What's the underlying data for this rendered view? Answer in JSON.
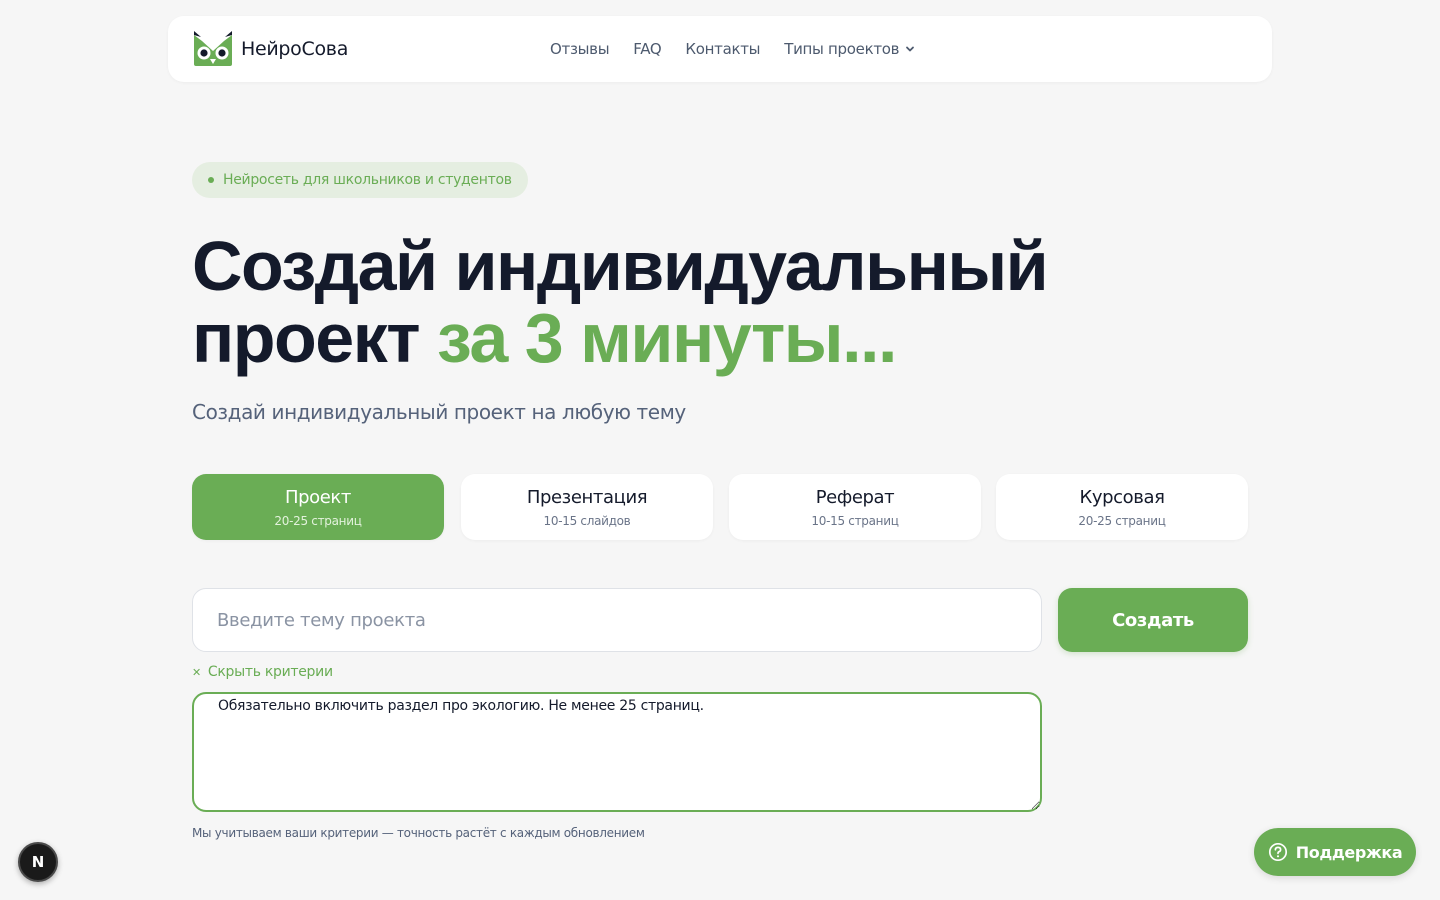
{
  "brand": {
    "name": "НейроСова",
    "logo_icon": "owl-logo-icon",
    "color": "#6aad55"
  },
  "nav": {
    "links": [
      "Отзывы",
      "FAQ",
      "Контакты"
    ],
    "dropdown_label": "Типы проектов",
    "dropdown_icon": "chevron-down-icon"
  },
  "hero": {
    "badge": "Нейросеть для школьников и студентов",
    "title_line1": "Создай индивидуальный",
    "title_line2_dark": "проект",
    "title_line2_accent": "за 3 минуты...",
    "subtitle": "Создай индивидуальный проект на любую тему"
  },
  "types": [
    {
      "title": "Проект",
      "sub": "20-25 страниц",
      "active": true
    },
    {
      "title": "Презентация",
      "sub": "10-15 слайдов",
      "active": false
    },
    {
      "title": "Реферат",
      "sub": "10-15 страниц",
      "active": false
    },
    {
      "title": "Курсовая",
      "sub": "20-25 страниц",
      "active": false
    }
  ],
  "form": {
    "topic_placeholder": "Введите тему проекта",
    "topic_value": "",
    "create_label": "Создать",
    "toggle_criteria_label": "Скрыть критерии",
    "toggle_icon": "close-icon",
    "criteria_value": "Обязательно включить раздел про экологию. Не менее 25 страниц.",
    "note": "Мы учитываем ваши критерии — точность растёт с каждым обновлением"
  },
  "widgets": {
    "dev_badge": "N",
    "support_label": "Поддержка",
    "support_icon": "help-circle-icon"
  },
  "colors": {
    "accent": "#6aad55",
    "dark": "#141a2b",
    "muted": "#55627a",
    "background": "#f6f6f6"
  }
}
